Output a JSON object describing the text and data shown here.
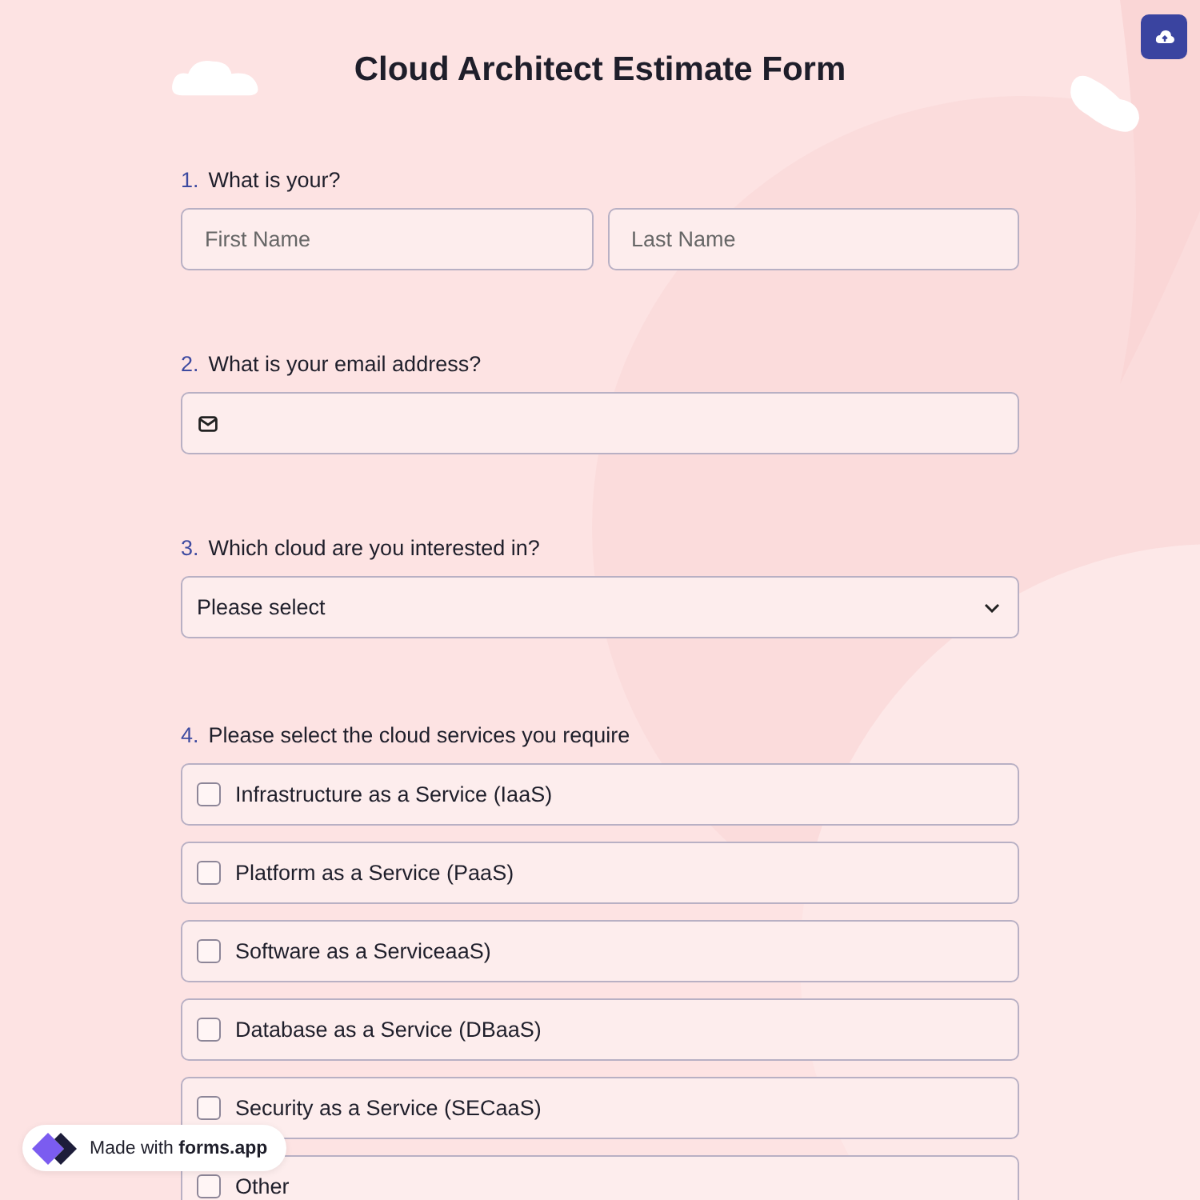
{
  "title": "Cloud Architect Estimate Form",
  "questions": [
    {
      "number": "1.",
      "label": "What is your?",
      "kind": "name",
      "fields": [
        {
          "placeholder": "First Name"
        },
        {
          "placeholder": "Last Name"
        }
      ]
    },
    {
      "number": "2.",
      "label": "What is your email address?",
      "kind": "email"
    },
    {
      "number": "3.",
      "label": "Which cloud are you interested in?",
      "kind": "select",
      "value": "Please select"
    },
    {
      "number": "4.",
      "label": "Please select the cloud services you require",
      "kind": "checkboxes",
      "options": [
        {
          "label": "Infrastructure as a Service (IaaS)",
          "checked": false
        },
        {
          "label": "Platform as a Service (PaaS)",
          "checked": false
        },
        {
          "label": "Software as a ServiceaaS)",
          "checked": false
        },
        {
          "label": "Database as a Service (DBaaS)",
          "checked": false
        },
        {
          "label": "Security as a Service (SECaaS)",
          "checked": false
        },
        {
          "label": "Other",
          "checked": false
        }
      ]
    }
  ],
  "badge": {
    "text": "Made with **forms.app**"
  }
}
